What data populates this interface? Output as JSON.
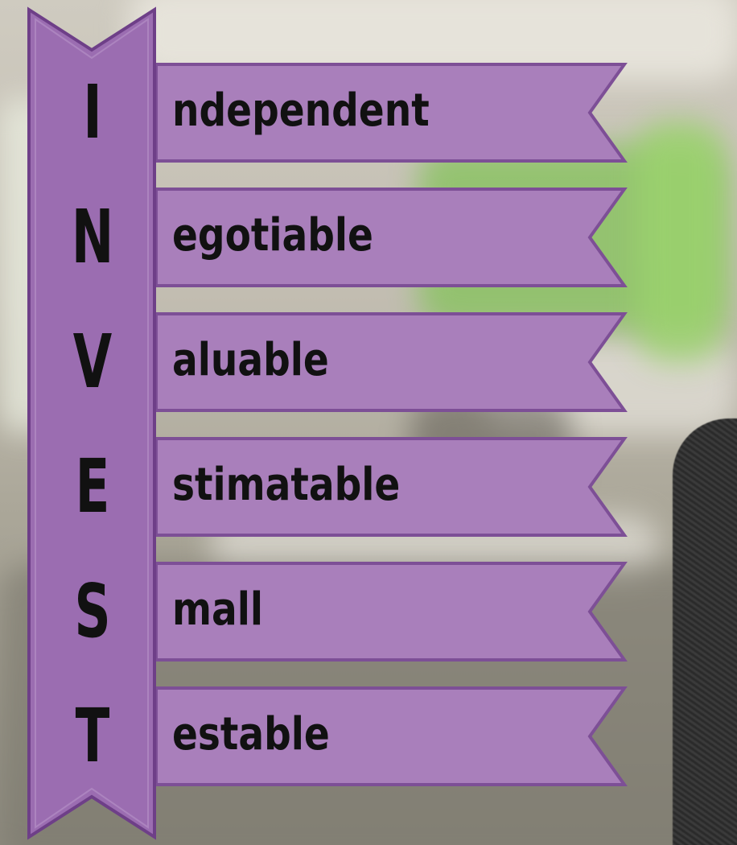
{
  "acronym": {
    "rows": [
      {
        "letter": "I",
        "word": "ndependent"
      },
      {
        "letter": "N",
        "word": "egotiable"
      },
      {
        "letter": "V",
        "word": "aluable"
      },
      {
        "letter": "E",
        "word": "stimatable"
      },
      {
        "letter": "S",
        "word": "mall"
      },
      {
        "letter": "T",
        "word": "estable"
      }
    ]
  },
  "colors": {
    "ribbon_fill": "#a97fbb",
    "ribbon_edge": "#7d4f96",
    "banner_fill": "#9b6db1",
    "text": "#111111"
  }
}
